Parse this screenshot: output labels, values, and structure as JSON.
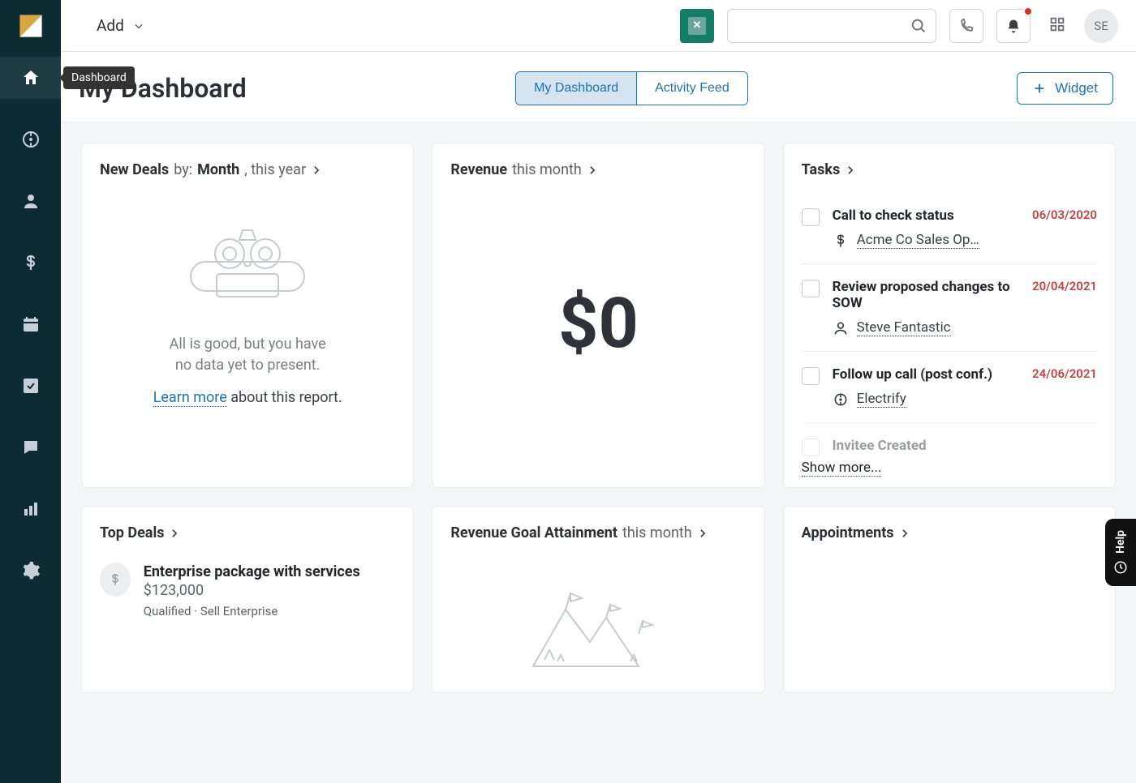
{
  "sidebar": {
    "tooltip": "Dashboard"
  },
  "topbar": {
    "add_label": "Add",
    "avatar_initials": "SE"
  },
  "header": {
    "page_title": "My Dashboard",
    "tab_dashboard": "My Dashboard",
    "tab_activity": "Activity Feed",
    "widget_button": "Widget"
  },
  "new_deals": {
    "title_bold1": "New Deals",
    "by_label": "by:",
    "title_bold2": "Month",
    "range": ", this year",
    "empty_line1": "All is good, but you have",
    "empty_line2": "no data yet to present.",
    "learn_more": "Learn more",
    "about_report": " about this report."
  },
  "revenue": {
    "title_bold": "Revenue",
    "range": "this month",
    "value": "$0"
  },
  "tasks": {
    "title": "Tasks",
    "items": [
      {
        "title": "Call to check status",
        "date": "06/03/2020",
        "rel_type": "deal",
        "rel_label": "Acme Co Sales Op…"
      },
      {
        "title": "Review proposed changes to SOW",
        "date": "20/04/2021",
        "rel_type": "person",
        "rel_label": "Steve Fantastic"
      },
      {
        "title": "Follow up call (post conf.)",
        "date": "24/06/2021",
        "rel_type": "lead",
        "rel_label": "Electrify"
      },
      {
        "title": "Invitee Created",
        "date": "",
        "rel_type": "",
        "rel_label": ""
      }
    ],
    "show_more": "Show more..."
  },
  "top_deals": {
    "title": "Top Deals",
    "deal_name": "Enterprise package with services",
    "deal_amount": "$123,000",
    "deal_meta": "Qualified · Sell Enterprise"
  },
  "revenue_goal": {
    "title_bold": "Revenue Goal Attainment",
    "range": "this month"
  },
  "appointments": {
    "title": "Appointments"
  },
  "help": {
    "label": "Help"
  }
}
